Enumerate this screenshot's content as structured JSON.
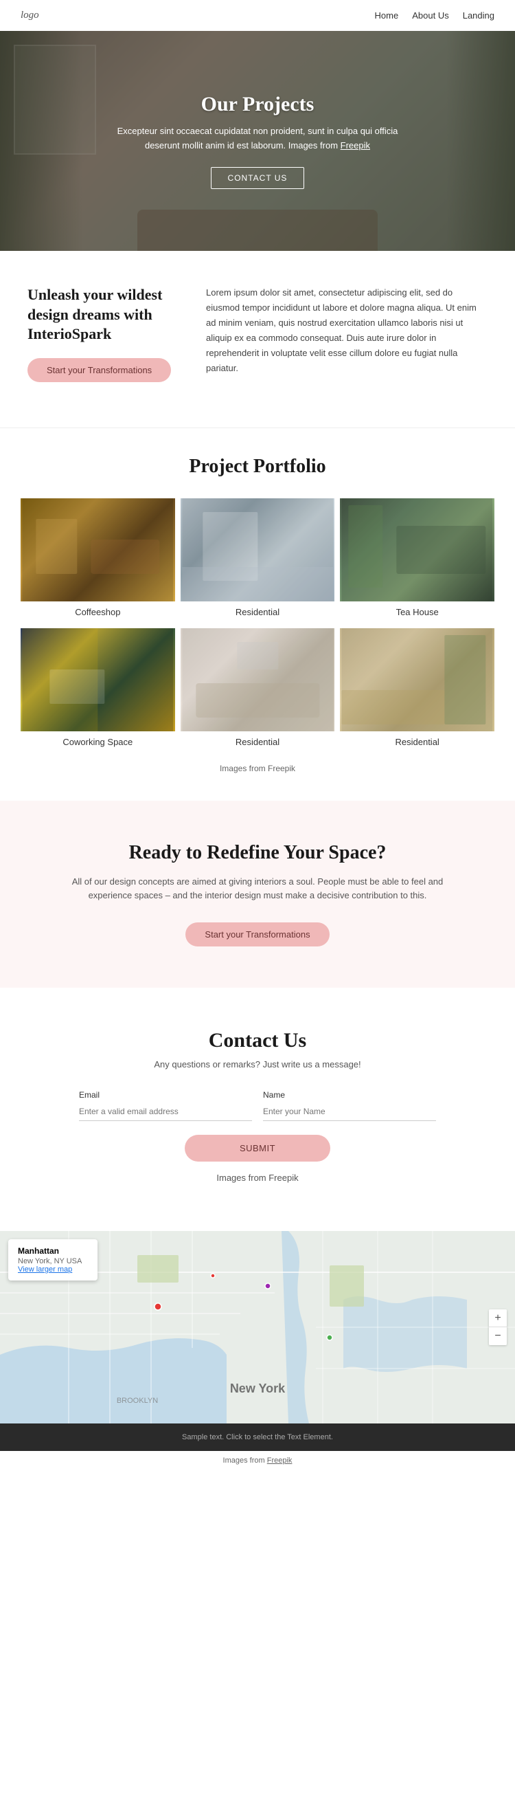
{
  "nav": {
    "logo": "logo",
    "links": [
      {
        "label": "Home",
        "href": "#"
      },
      {
        "label": "About Us",
        "href": "#"
      },
      {
        "label": "Landing",
        "href": "#"
      }
    ]
  },
  "hero": {
    "title": "Our Projects",
    "subtitle": "Excepteur sint occaecat cupidatat non proident, sunt in culpa qui officia deserunt mollit anim id est laborum. Images from",
    "freepik_link": "Freepik",
    "cta_label": "CONTACT US"
  },
  "intro": {
    "heading": "Unleash your wildest design dreams with InterioSpark",
    "body": "Lorem ipsum dolor sit amet, consectetur adipiscing elit, sed do eiusmod tempor incididunt ut labore et dolore magna aliqua. Ut enim ad minim veniam, quis nostrud exercitation ullamco laboris nisi ut aliquip ex ea commodo consequat. Duis aute irure dolor in reprehenderit in voluptate velit esse cillum dolore eu fugiat nulla pariatur.",
    "cta_label": "Start your Transformations"
  },
  "portfolio": {
    "title": "Project Portfolio",
    "items": [
      {
        "label": "Coffeeshop",
        "theme": "coffeeshop"
      },
      {
        "label": "Residential",
        "theme": "residential1"
      },
      {
        "label": "Tea House",
        "theme": "teahouse"
      },
      {
        "label": "Coworking Space",
        "theme": "coworking"
      },
      {
        "label": "Residential",
        "theme": "residential2"
      },
      {
        "label": "Residential",
        "theme": "residential3"
      }
    ],
    "footer": "Images from Freepik"
  },
  "cta": {
    "heading": "Ready to Redefine Your Space?",
    "body": "All of our design concepts are aimed at giving interiors a soul. People must be able to feel and experience spaces – and the interior design must make a decisive contribution to this.",
    "cta_label": "Start your Transformations"
  },
  "contact": {
    "heading": "Contact Us",
    "subtitle": "Any questions or remarks? Just write us a message!",
    "form": {
      "email_label": "Email",
      "email_placeholder": "Enter a valid email address",
      "name_label": "Name",
      "name_placeholder": "Enter your Name",
      "submit_label": "SUBMIT"
    },
    "footer": "Images from Freepik"
  },
  "map": {
    "location_name": "Manhattan",
    "address": "New York, NY USA",
    "link_label": "View larger map",
    "city_label": "New York",
    "zoom_in": "+",
    "zoom_out": "−"
  },
  "footer": {
    "sample_text": "Sample text. Click to select the Text Element.",
    "images_text": "Images from",
    "freepik_link": "Freepik"
  }
}
